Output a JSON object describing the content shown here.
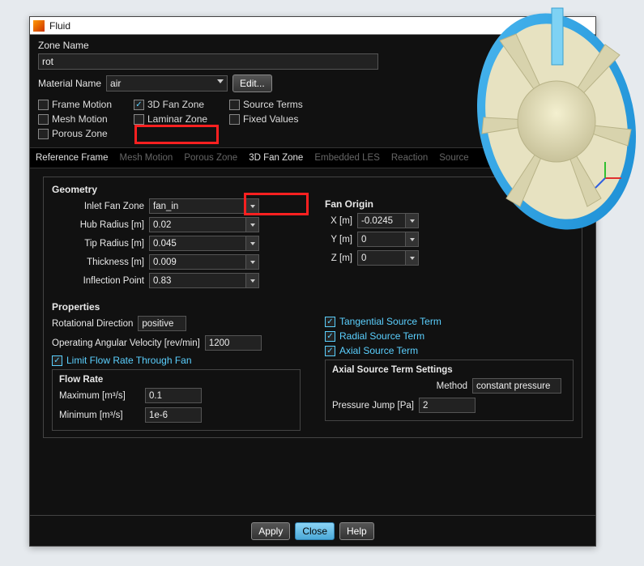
{
  "window": {
    "title": "Fluid"
  },
  "zone": {
    "label": "Zone Name",
    "value": "rot"
  },
  "material": {
    "label": "Material Name",
    "value": "air",
    "edit": "Edit..."
  },
  "options": {
    "frame_motion": "Frame Motion",
    "fan3d": "3D Fan Zone",
    "source_terms": "Source Terms",
    "mesh_motion": "Mesh Motion",
    "laminar": "Laminar Zone",
    "fixed_values": "Fixed Values",
    "porous": "Porous Zone"
  },
  "tabs": {
    "reference_frame": "Reference Frame",
    "mesh_motion": "Mesh Motion",
    "porous_zone": "Porous Zone",
    "fan3d": "3D Fan Zone",
    "embedded_les": "Embedded LES",
    "reaction": "Reaction",
    "source": "Source"
  },
  "geometry": {
    "title": "Geometry",
    "inlet_label": "Inlet Fan Zone",
    "inlet_value": "fan_in",
    "hub_label": "Hub Radius [m]",
    "hub_value": "0.02",
    "tip_label": "Tip Radius [m]",
    "tip_value": "0.045",
    "thick_label": "Thickness [m]",
    "thick_value": "0.009",
    "inflect_label": "Inflection Point",
    "inflect_value": "0.83",
    "origin_title": "Fan Origin",
    "x_label": "X [m]",
    "x_value": "-0.0245",
    "y_label": "Y [m]",
    "y_value": "0",
    "z_label": "Z [m]",
    "z_value": "0"
  },
  "properties": {
    "title": "Properties",
    "rot_dir_label": "Rotational Direction",
    "rot_dir_value": "positive",
    "ang_vel_label": "Operating Angular Velocity [rev/min]",
    "ang_vel_value": "1200",
    "limit_flow": "Limit Flow Rate Through Fan",
    "tangential": "Tangential Source Term",
    "radial": "Radial Source Term",
    "axial": "Axial Source Term",
    "flow_rate_title": "Flow Rate",
    "max_label": "Maximum [m³/s]",
    "max_value": "0.1",
    "min_label": "Minimum [m³/s]",
    "min_value": "1e-6",
    "axial_settings_title": "Axial Source Term Settings",
    "method_label": "Method",
    "method_value": "constant pressure",
    "pjump_label": "Pressure Jump [Pa]",
    "pjump_value": "2"
  },
  "buttons": {
    "apply": "Apply",
    "close": "Close",
    "help": "Help"
  }
}
